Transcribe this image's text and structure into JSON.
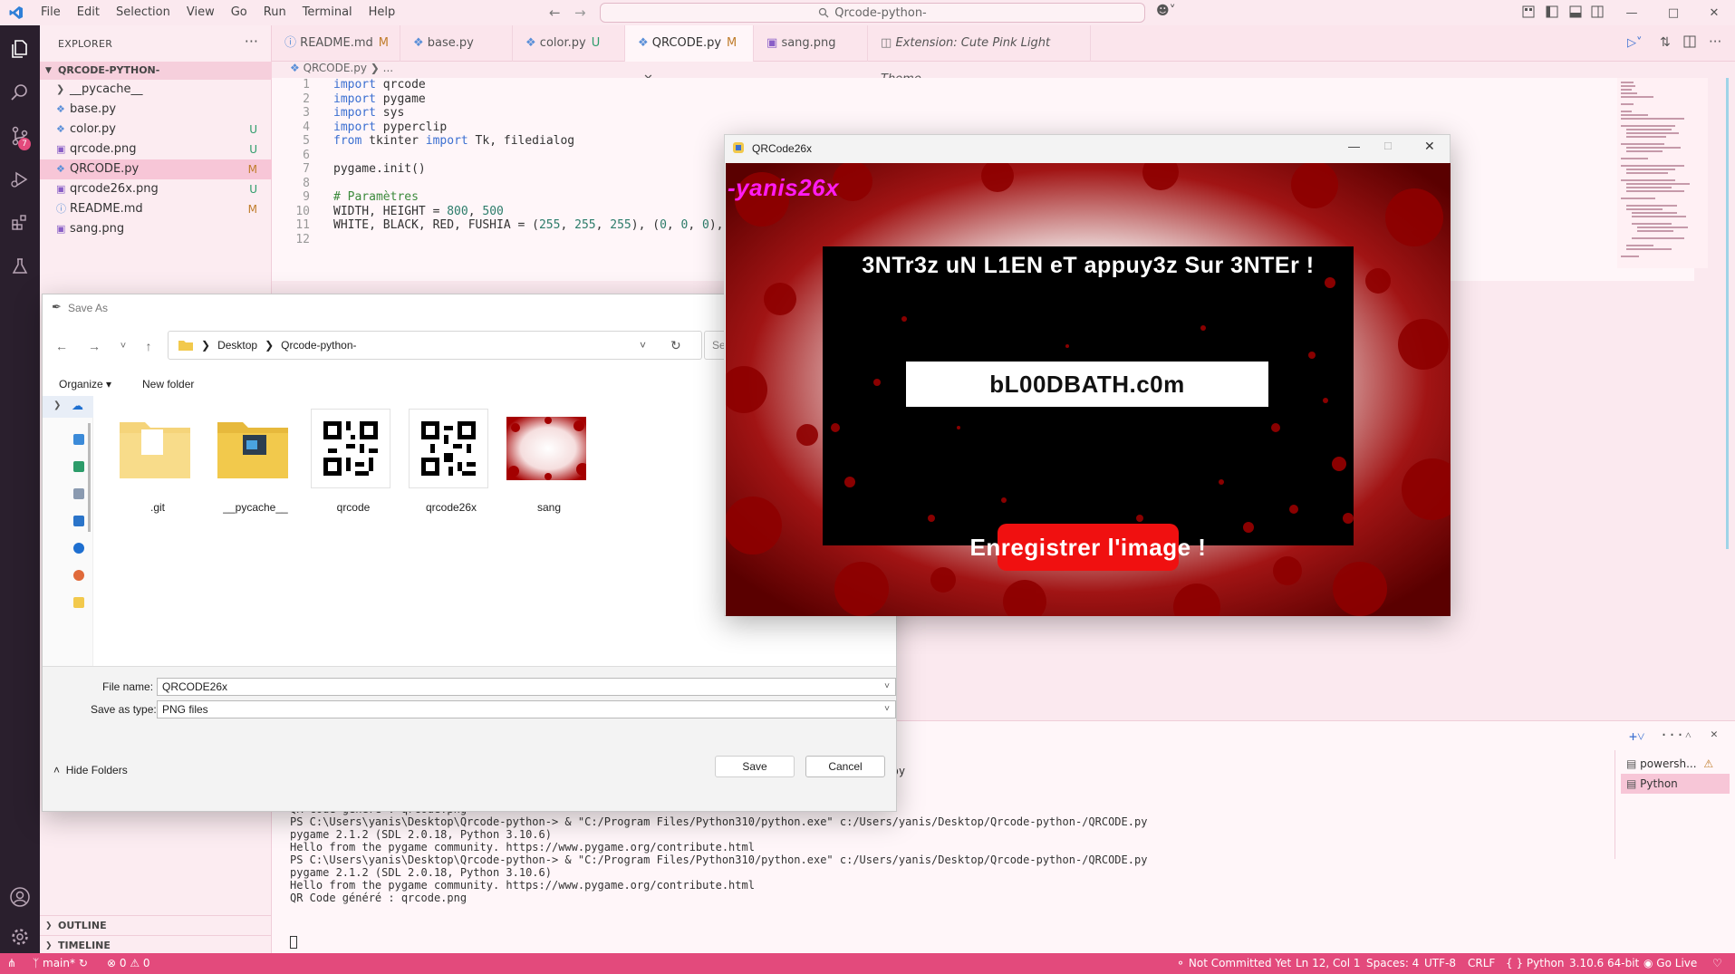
{
  "window": {
    "search_text": "Qrcode-python-",
    "menu": [
      "File",
      "Edit",
      "Selection",
      "View",
      "Go",
      "Run",
      "Terminal",
      "Help"
    ]
  },
  "activity": {
    "source_control_badge": "7"
  },
  "sidebar": {
    "title": "EXPLORER",
    "more": "···",
    "folder": "QRCODE-PYTHON-",
    "items": [
      {
        "name": "__pycache__",
        "status": "",
        "type": "folder"
      },
      {
        "name": "base.py",
        "status": "",
        "type": "py"
      },
      {
        "name": "color.py",
        "status": "U",
        "type": "py"
      },
      {
        "name": "qrcode.png",
        "status": "U",
        "type": "png"
      },
      {
        "name": "QRCODE.py",
        "status": "M",
        "type": "py"
      },
      {
        "name": "qrcode26x.png",
        "status": "U",
        "type": "png"
      },
      {
        "name": "README.md",
        "status": "M",
        "type": "md"
      },
      {
        "name": "sang.png",
        "status": "",
        "type": "png"
      }
    ],
    "outline": "OUTLINE",
    "timeline": "TIMELINE"
  },
  "tabs": [
    {
      "label": "README.md",
      "mark": "M"
    },
    {
      "label": "base.py",
      "mark": ""
    },
    {
      "label": "color.py",
      "mark": "U"
    },
    {
      "label": "QRCODE.py",
      "mark": "M"
    },
    {
      "label": "sang.png",
      "mark": ""
    },
    {
      "label": "Extension: Cute Pink Light Theme",
      "mark": ""
    }
  ],
  "breadcrumb": {
    "file": "QRCODE.py",
    "rest": "..."
  },
  "editor": {
    "line_numbers": [
      "1",
      "2",
      "3",
      "4",
      "5",
      "6",
      "7",
      "8",
      "9",
      "10",
      "11",
      "12"
    ],
    "lines": [
      "import qrcode",
      "import pygame",
      "import sys",
      "import pyperclip",
      "from tkinter import Tk, filedialog",
      "",
      "pygame.init()",
      "",
      "# Paramètres",
      "WIDTH, HEIGHT = 800, 500",
      "WHITE, BLACK, RED, FUSHIA = (255, 255, 255), (0, 0, 0),",
      ""
    ]
  },
  "terminal": {
    "lines": [
      "                                                           is/Desktop/Qrcode-python-/QRCODE.py",
      "",
      "",
      "QR Code généré : qrcode.png",
      "PS C:\\Users\\yanis\\Desktop\\Qrcode-python-> & \"C:/Program Files/Python310/python.exe\" c:/Users/yanis/Desktop/Qrcode-python-/QRCODE.py",
      "pygame 2.1.2 (SDL 2.0.18, Python 3.10.6)",
      "Hello from the pygame community. https://www.pygame.org/contribute.html",
      "PS C:\\Users\\yanis\\Desktop\\Qrcode-python-> & \"C:/Program Files/Python310/python.exe\" c:/Users/yanis/Desktop/Qrcode-python-/QRCODE.py",
      "pygame 2.1.2 (SDL 2.0.18, Python 3.10.6)",
      "Hello from the pygame community. https://www.pygame.org/contribute.html",
      "QR Code généré : qrcode.png"
    ],
    "sessions": [
      "powersh...",
      "Python"
    ]
  },
  "statusbar": {
    "branch": "main*",
    "problems": "0",
    "warnings": "0",
    "commit": "Not Committed Yet",
    "position": "Ln 12, Col 1",
    "spaces": "Spaces: 4",
    "encoding": "UTF-8",
    "eol": "CRLF",
    "language": "Python",
    "interpreter": "3.10.6 64-bit",
    "golive": "Go Live"
  },
  "saveas": {
    "title": "Save As",
    "path": [
      "Desktop",
      "Qrcode-python-"
    ],
    "search_placeholder": "Se",
    "organize": "Organize",
    "new_folder": "New folder",
    "files": [
      {
        "name": ".git",
        "kind": "folder"
      },
      {
        "name": "__pycache__",
        "kind": "folder-vscode"
      },
      {
        "name": "qrcode",
        "kind": "qr"
      },
      {
        "name": "qrcode26x",
        "kind": "qr"
      },
      {
        "name": "sang",
        "kind": "image"
      }
    ],
    "file_name_label": "File name:",
    "file_name": "QRCODE26x",
    "save_type_label": "Save as type:",
    "save_type": "PNG files",
    "hide_folders": "Hide Folders",
    "save": "Save",
    "cancel": "Cancel"
  },
  "qrwin": {
    "title": "QRCode26x",
    "watermark": "-yanis26x",
    "headline": "3NTr3z uN L1EN eT appuy3z Sur 3NTEr !",
    "url": "bL00DBATH.c0m",
    "save_button": "Enregistrer l'image !"
  }
}
